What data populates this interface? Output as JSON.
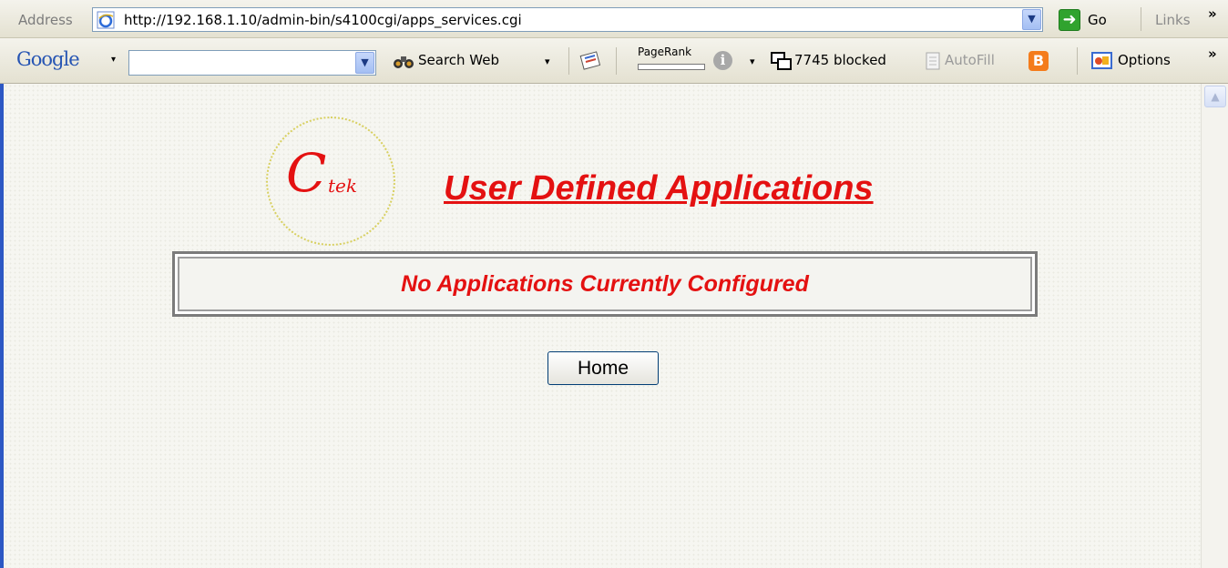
{
  "address_bar": {
    "label": "Address",
    "url": "http://192.168.1.10/admin-bin/s4100cgi/apps_services.cgi",
    "go_label": "Go",
    "links_label": "Links",
    "chevron": "»"
  },
  "google_toolbar": {
    "logo": "Google",
    "logo_menu_arrow": "▾",
    "search_value": "",
    "search_web_label": "Search Web",
    "search_web_arrow": "▾",
    "pagerank_label": "PageRank",
    "info_arrow": "▾",
    "blocked_label": "7745 blocked",
    "autofill_label": "AutoFill",
    "blogger_letter": "B",
    "options_label": "Options",
    "chevron": "»"
  },
  "page": {
    "logo_initial": "C",
    "logo_suffix": "tek",
    "title": "User Defined Applications",
    "message": "No Applications Currently Configured",
    "home_button": "Home"
  },
  "icons": [
    "ie-page-icon",
    "dropdown-arrow-icon",
    "go-arrow-icon",
    "binoculars-icon",
    "news-icon",
    "info-icon",
    "popup-blocker-icon",
    "autofill-icon",
    "blogger-icon",
    "options-icon",
    "scroll-up-icon"
  ],
  "colors": {
    "accent_red": "#e41111",
    "window_blue": "#2d58c4",
    "go_green": "#30a32e",
    "blogger_orange": "#f47c1c"
  }
}
